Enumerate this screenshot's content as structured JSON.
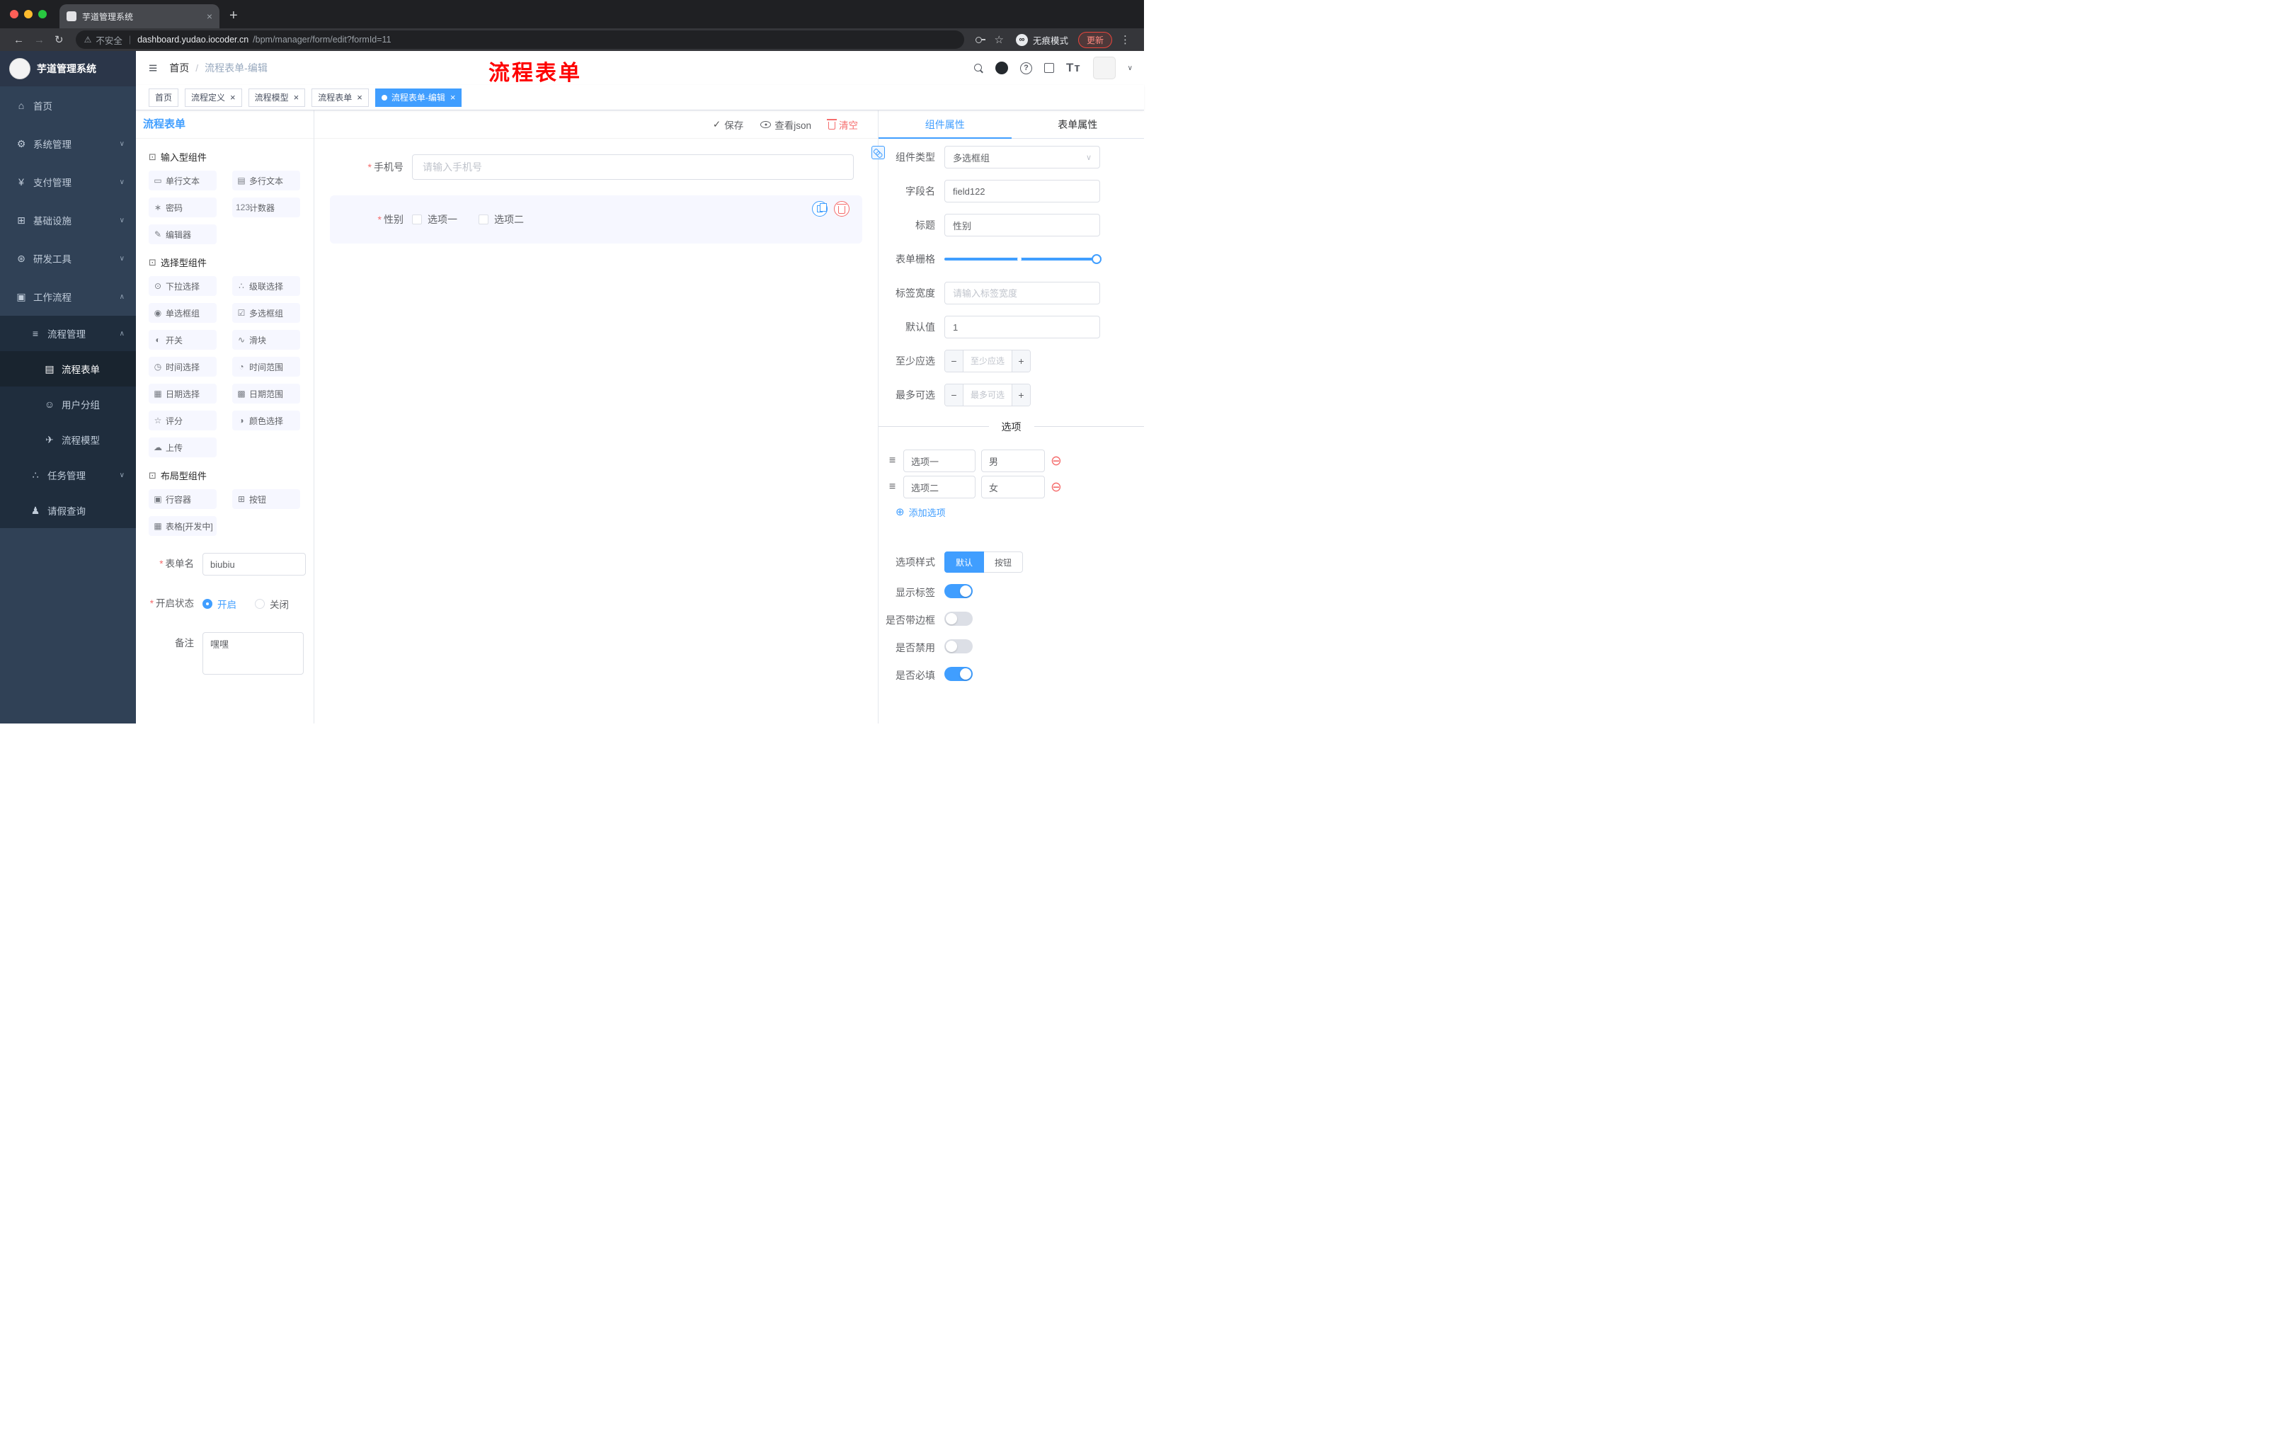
{
  "ui": {
    "required_mark": "*",
    "chevron_down": "∨",
    "chevron_up": "∧",
    "close": "×",
    "check": "✓",
    "handle": "≡",
    "remove": "⊖",
    "plus_circle": "⊕",
    "minus": "−",
    "plus": "+",
    "question": "?"
  },
  "colors": {
    "accent": "#409eff",
    "danger": "#f56c6c",
    "sidebar_bg": "#304156",
    "submenu_bg": "#1f2d3d",
    "annotation": "#fe0000",
    "update_chip": "#e8453c"
  },
  "browser": {
    "tab_title": "芋道管理系统",
    "tab_close": "×",
    "new_tab": "+",
    "back": "←",
    "forward": "→",
    "reload": "↻",
    "warning": "⚠",
    "security_label": "不安全",
    "divider": "|",
    "url_host": "dashboard.yudao.iocoder.cn",
    "url_path": "/bpm/manager/form/edit?formId=11",
    "star_icon": "☆",
    "incognito_glyph": "∞",
    "incognito_label": "无痕模式",
    "update_label": "更新",
    "menu_icon": "⋮"
  },
  "sidebar": {
    "logo_text": "芋道管理系统",
    "items": [
      {
        "key": "home",
        "icon": "⌂",
        "label": "首页",
        "level": 1
      },
      {
        "key": "system",
        "icon": "⚙",
        "label": "系统管理",
        "level": 1,
        "chevron": "down"
      },
      {
        "key": "payment",
        "icon": "¥",
        "label": "支付管理",
        "level": 1,
        "chevron": "down"
      },
      {
        "key": "infra",
        "icon": "⊞",
        "label": "基础设施",
        "level": 1,
        "chevron": "down"
      },
      {
        "key": "devtools",
        "icon": "⊛",
        "label": "研发工具",
        "level": 1,
        "chevron": "down"
      },
      {
        "key": "workflow",
        "icon": "▣",
        "label": "工作流程",
        "level": 1,
        "chevron": "up",
        "open": true
      },
      {
        "key": "process-management",
        "icon": "≡",
        "label": "流程管理",
        "level": 2,
        "chevron": "up"
      },
      {
        "key": "process-form",
        "icon": "▤",
        "label": "流程表单",
        "level": 3,
        "active": true
      },
      {
        "key": "user-group",
        "icon": "☺",
        "label": "用户分组",
        "level": 3
      },
      {
        "key": "process-model",
        "icon": "✈",
        "label": "流程模型",
        "level": 3
      },
      {
        "key": "task-management",
        "icon": "∴",
        "label": "任务管理",
        "level": 2,
        "chevron": "down"
      },
      {
        "key": "leave-query",
        "icon": "♟",
        "label": "请假查询",
        "level": 2
      }
    ]
  },
  "header": {
    "hamburger": "≡",
    "breadcrumb_home": "首页",
    "breadcrumb_sep": "/",
    "breadcrumb_current": "流程表单-编辑",
    "annotation": "流程表单",
    "font_icon": "Tᴛ",
    "dropdown_icon": "∨"
  },
  "tags": [
    {
      "key": "home",
      "label": "首页"
    },
    {
      "key": "process-definition",
      "label": "流程定义",
      "closable": true
    },
    {
      "key": "process-model",
      "label": "流程模型",
      "closable": true
    },
    {
      "key": "process-form",
      "label": "流程表单",
      "closable": true
    },
    {
      "key": "process-form-edit",
      "label": "流程表单-编辑",
      "closable": true,
      "active": true
    }
  ],
  "palette": {
    "title": "流程表单",
    "section_icon": "⊡",
    "sections": [
      {
        "key": "input",
        "title": "输入型组件",
        "items": [
          {
            "key": "single-line-text",
            "icon": "▭",
            "label": "单行文本"
          },
          {
            "key": "multi-line-text",
            "icon": "▤",
            "label": "多行文本"
          },
          {
            "key": "password",
            "icon": "∗",
            "label": "密码"
          },
          {
            "key": "counter",
            "icon": "123",
            "label": "计数器"
          },
          {
            "key": "editor",
            "icon": "✎",
            "label": "编辑器"
          }
        ]
      },
      {
        "key": "select",
        "title": "选择型组件",
        "items": [
          {
            "key": "select",
            "icon": "⊙",
            "label": "下拉选择"
          },
          {
            "key": "cascader",
            "icon": "∴",
            "label": "级联选择"
          },
          {
            "key": "radio-group",
            "icon": "◉",
            "label": "单选框组"
          },
          {
            "key": "checkbox-group",
            "icon": "☑",
            "label": "多选框组"
          },
          {
            "key": "switch",
            "icon": "◐",
            "label": "开关"
          },
          {
            "key": "slider",
            "icon": "∿",
            "label": "滑块"
          },
          {
            "key": "time-picker",
            "icon": "◷",
            "label": "时间选择"
          },
          {
            "key": "time-range",
            "icon": "◔",
            "label": "时间范围"
          },
          {
            "key": "date-picker",
            "icon": "▦",
            "label": "日期选择"
          },
          {
            "key": "date-range",
            "icon": "▩",
            "label": "日期范围"
          },
          {
            "key": "rate",
            "icon": "☆",
            "label": "评分"
          },
          {
            "key": "color-picker",
            "icon": "◑",
            "label": "颜色选择"
          },
          {
            "key": "upload",
            "icon": "☁",
            "label": "上传"
          }
        ]
      },
      {
        "key": "layout",
        "title": "布局型组件",
        "items": [
          {
            "key": "row-container",
            "icon": "▣",
            "label": "行容器"
          },
          {
            "key": "button",
            "icon": "⊞",
            "label": "按钮"
          },
          {
            "key": "table",
            "icon": "▦",
            "label": "表格[开发中]"
          }
        ]
      }
    ],
    "form": {
      "name_label": "表单名",
      "name_value": "biubiu",
      "status_label": "开启状态",
      "status_options": [
        {
          "key": "open",
          "label": "开启",
          "checked": true
        },
        {
          "key": "closed",
          "label": "关闭",
          "checked": false
        }
      ],
      "remark_label": "备注",
      "remark_value": "嘿嘿"
    }
  },
  "canvas": {
    "toolbar": {
      "save": "保存",
      "view_json": "查看json",
      "clear": "清空"
    },
    "fields": {
      "phone": {
        "label": "手机号",
        "placeholder": "请输入手机号",
        "required": true
      },
      "gender": {
        "label": "性别",
        "required": true,
        "options": [
          "选项一",
          "选项二"
        ]
      }
    }
  },
  "props": {
    "tabs": [
      {
        "key": "component",
        "label": "组件属性",
        "active": true
      },
      {
        "key": "form",
        "label": "表单属性",
        "active": false
      }
    ],
    "fields": {
      "type_label": "组件类型",
      "type_value": "多选框组",
      "field_label": "字段名",
      "field_value": "field122",
      "title_label": "标题",
      "title_value": "性别",
      "grid_label": "表单栅格",
      "width_label": "标签宽度",
      "width_placeholder": "请输入标签宽度",
      "default_label": "默认值",
      "default_value": "1",
      "min_label": "至少应选",
      "min_placeholder": "至少应选",
      "max_label": "最多可选",
      "max_placeholder": "最多可选"
    },
    "options_divider": "选项",
    "options": [
      {
        "key": "option-1",
        "label": "选项一",
        "value": "男"
      },
      {
        "key": "option-2",
        "label": "选项二",
        "value": "女"
      }
    ],
    "add_option": "添加选项",
    "style_label": "选项样式",
    "style_options": [
      {
        "key": "default",
        "label": "默认",
        "active": true
      },
      {
        "key": "button",
        "label": "按钮",
        "active": false
      }
    ],
    "switches": [
      {
        "key": "show-label",
        "label": "显示标签",
        "on": true
      },
      {
        "key": "border",
        "label": "是否带边框",
        "on": false
      },
      {
        "key": "disabled",
        "label": "是否禁用",
        "on": false
      },
      {
        "key": "required",
        "label": "是否必填",
        "on": true
      }
    ]
  }
}
